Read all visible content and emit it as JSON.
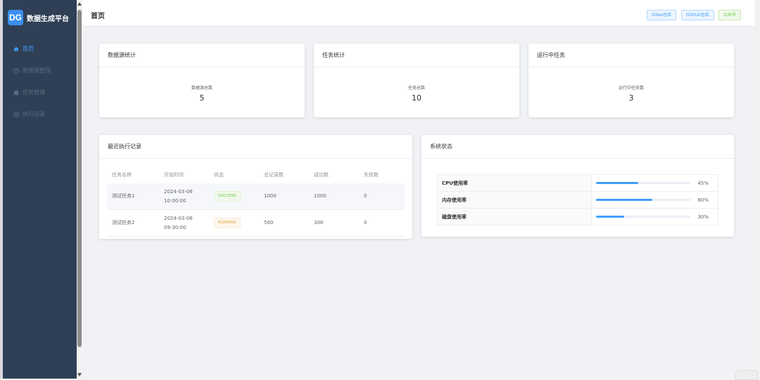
{
  "sidebar": {
    "brand_logo": "DG",
    "brand_name": "数据生成平台",
    "items": [
      {
        "label": "首页",
        "icon": "home-icon",
        "active": true
      },
      {
        "label": "数据源管理",
        "icon": "database-icon",
        "active": false
      },
      {
        "label": "任务管理",
        "icon": "task-icon",
        "active": false
      },
      {
        "label": "执行记录",
        "icon": "record-icon",
        "active": false
      }
    ]
  },
  "header": {
    "title": "首页",
    "links": [
      "Gitee仓库",
      "GitHub仓库",
      "公众号"
    ]
  },
  "stats": [
    {
      "title": "数据源统计",
      "label": "数据源总数",
      "value": "5"
    },
    {
      "title": "任务统计",
      "label": "任务总数",
      "value": "10"
    },
    {
      "title": "运行中任务",
      "label": "运行中任务数",
      "value": "3"
    }
  ],
  "recent": {
    "title": "最近执行记录",
    "columns": [
      "任务名称",
      "开始时间",
      "状态",
      "总记录数",
      "成功数",
      "失败数"
    ],
    "rows": [
      {
        "name": "测试任务1",
        "date": "2024-03-06",
        "time": "10:00:00",
        "status": "SUCCESS",
        "total": "1000",
        "success": "1000",
        "fail": "0"
      },
      {
        "name": "测试任务2",
        "date": "2024-03-06",
        "time": "09:30:00",
        "status": "RUNNING",
        "total": "500",
        "success": "300",
        "fail": "0"
      }
    ]
  },
  "system": {
    "title": "系统状态",
    "metrics": [
      {
        "label": "CPU使用率",
        "percent": 45,
        "text": "45%"
      },
      {
        "label": "内存使用率",
        "percent": 60,
        "text": "60%"
      },
      {
        "label": "磁盘使用率",
        "percent": 30,
        "text": "30%"
      }
    ]
  },
  "colors": {
    "sidebar_bg": "#2f4056",
    "accent": "#409eff",
    "success": "#67c23a",
    "warning": "#e6a23c"
  }
}
